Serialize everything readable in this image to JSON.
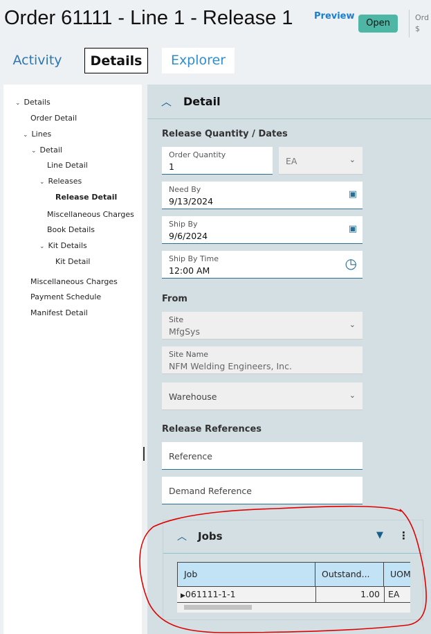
{
  "header": {
    "title": "Order 61111 - Line 1 - Release 1",
    "preview": "Preview",
    "status": "Open",
    "side_label": "Ord",
    "side_value": "$"
  },
  "tabs": [
    "Activity",
    "Details",
    "Explorer"
  ],
  "tree": [
    "Details",
    "Order Detail",
    "Lines",
    "Detail",
    "Line Detail",
    "Releases",
    "Release Detail",
    "Miscellaneous Charges",
    "Book Details",
    "Kit Details",
    "Kit Detail",
    "Miscellaneous Charges",
    "Payment Schedule",
    "Manifest Detail"
  ],
  "detail": {
    "title": "Detail",
    "section_qty": "Release Quantity / Dates",
    "order_qty_label": "Order Quantity",
    "order_qty": "1",
    "uom": "EA",
    "need_by_label": "Need By",
    "need_by": "9/13/2024",
    "ship_by_label": "Ship By",
    "ship_by": "9/6/2024",
    "ship_time_label": "Ship By Time",
    "ship_time": "12:00 AM",
    "section_from": "From",
    "site_label": "Site",
    "site": "MfgSys",
    "site_name_label": "Site Name",
    "site_name": "NFM Welding Engineers, Inc.",
    "warehouse": "Warehouse",
    "section_refs": "Release References",
    "reference": "Reference",
    "demand_reference": "Demand Reference"
  },
  "jobs": {
    "title": "Jobs",
    "columns": [
      "Job",
      "Outstand...",
      "UOM"
    ],
    "rows": [
      [
        "061111-1-1",
        "1.00",
        "EA"
      ]
    ]
  },
  "colors": {
    "accent": "#2a6e96",
    "status": "#4db6a5",
    "annotation": "#e00000"
  }
}
